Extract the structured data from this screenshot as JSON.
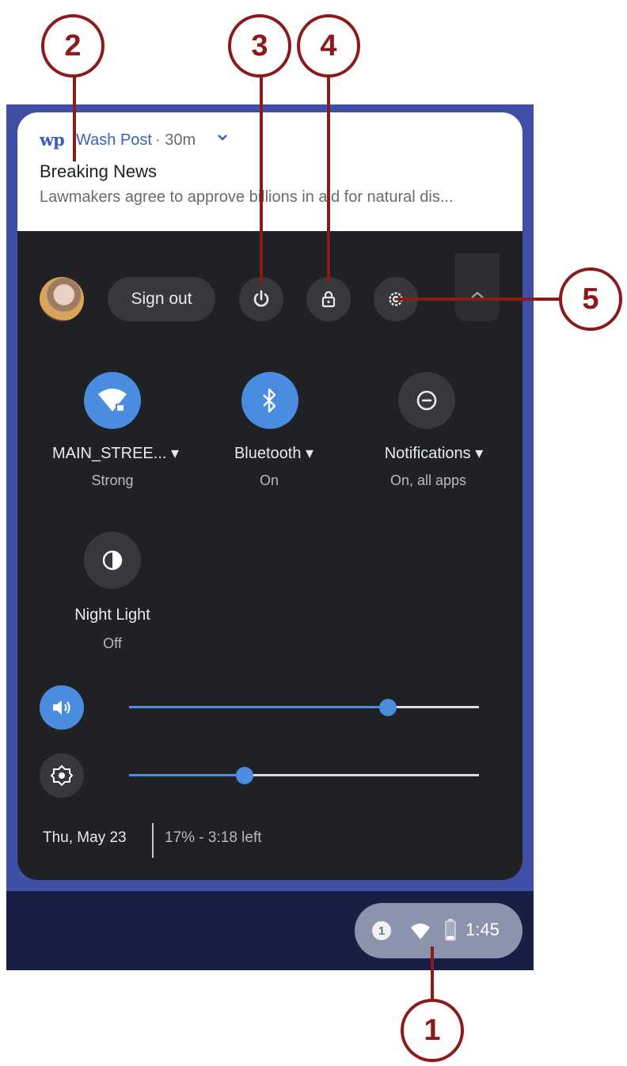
{
  "notification": {
    "logo": "wp",
    "source": "Wash Post",
    "time": "· 30m",
    "title": "Breaking News",
    "body": "Lawmakers agree to approve billions in aid for natural dis..."
  },
  "top_row": {
    "sign_out_label": "Sign out",
    "icons": [
      "power-icon",
      "lock-icon",
      "settings-icon"
    ]
  },
  "tiles": [
    {
      "label": "MAIN_STREE...",
      "status": "Strong",
      "active": true,
      "icon": "wifi-lock-icon"
    },
    {
      "label": "Bluetooth",
      "status": "On",
      "active": true,
      "icon": "bluetooth-icon"
    },
    {
      "label": "Notifications",
      "status": "On, all apps",
      "active": false,
      "icon": "do-not-disturb-icon"
    },
    {
      "label": "Night Light",
      "status": "Off",
      "active": false,
      "icon": "night-light-icon"
    }
  ],
  "sliders": {
    "volume_level": 0.74,
    "brightness_level": 0.33
  },
  "footer": {
    "date": "Thu, May 23",
    "battery": "17% - 3:18 left"
  },
  "status_area": {
    "notification_count": "1",
    "time": "1:45"
  },
  "callouts": [
    "1",
    "2",
    "3",
    "4",
    "5"
  ],
  "colors": {
    "accent": "#4a8de0",
    "panel": "#202124",
    "callout": "#8b1a1a"
  }
}
